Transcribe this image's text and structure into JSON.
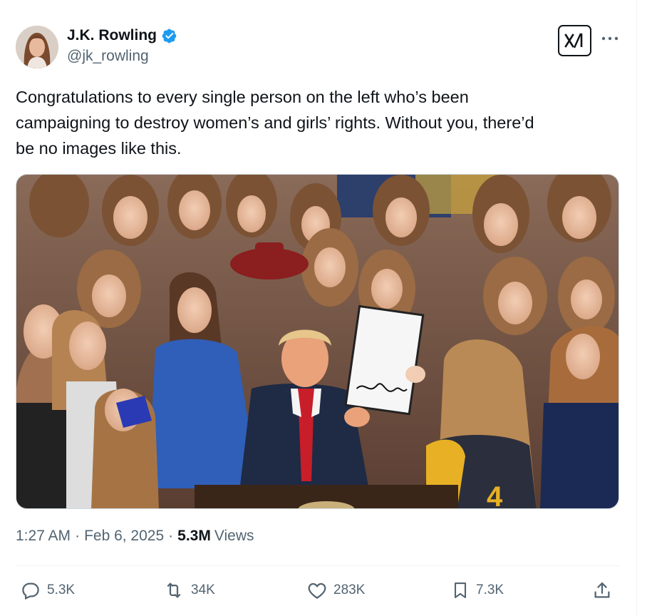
{
  "author": {
    "display_name": "J.K. Rowling",
    "handle": "@jk_rowling",
    "verified": true
  },
  "header": {
    "grok_icon": "xai-grok-icon",
    "more_icon": "more-dots-icon"
  },
  "tweet": {
    "text_line1": "Congratulations to every single person on the left who’s been",
    "text_line2": "campaigning to destroy women’s and girls’ rights. Without you, there’d",
    "text_line3": "be no images like this."
  },
  "meta": {
    "time": "1:27 AM",
    "date": "Feb 6, 2025",
    "separator": "·",
    "views_count": "5.3M",
    "views_label": "Views"
  },
  "actions": {
    "replies": "5.3K",
    "reposts": "34K",
    "likes": "283K",
    "bookmarks": "7.3K"
  },
  "colors": {
    "text_primary": "#0f1419",
    "text_secondary": "#536471",
    "verified_blue": "#1d9bf0",
    "divider": "#eff3f4"
  }
}
